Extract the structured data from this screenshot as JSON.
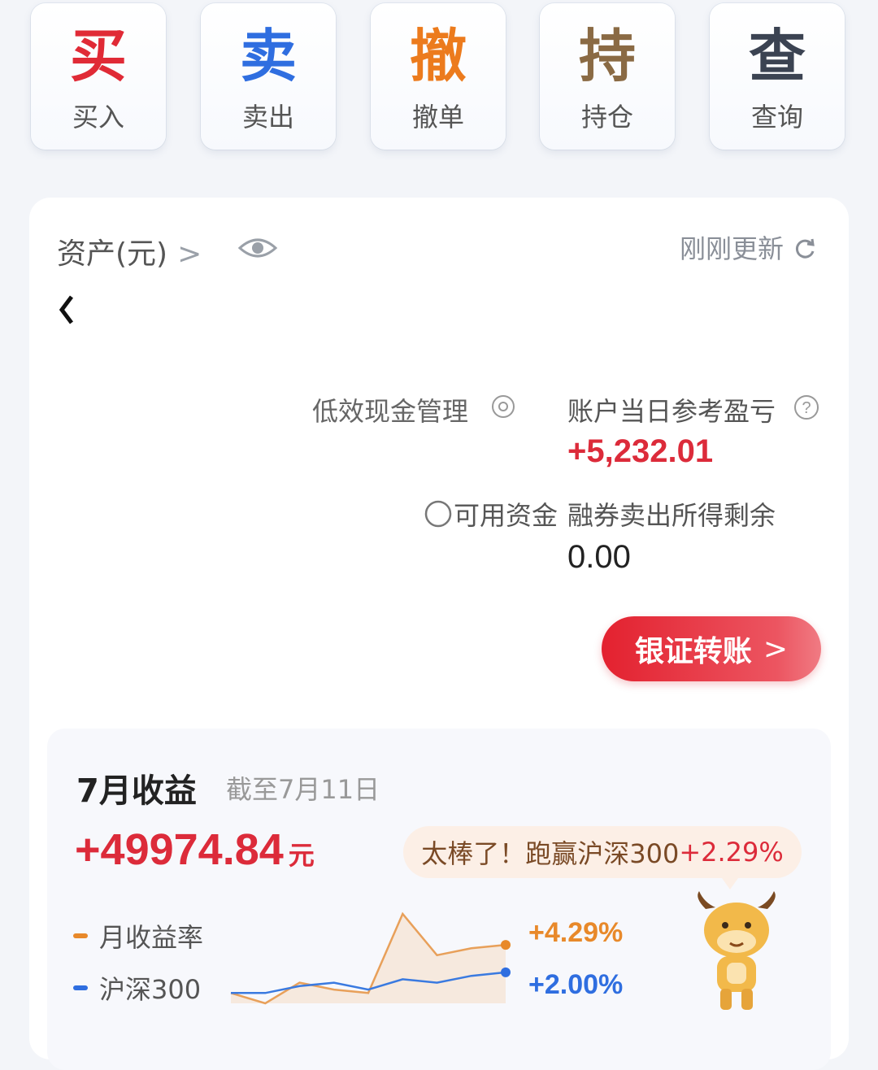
{
  "actions": [
    {
      "big": "买",
      "label": "买入"
    },
    {
      "big": "卖",
      "label": "卖出"
    },
    {
      "big": "撤",
      "label": "撤单"
    },
    {
      "big": "持",
      "label": "持仓"
    },
    {
      "big": "查",
      "label": "查询"
    }
  ],
  "assets": {
    "title": "资产(元)",
    "updated": "刚刚更新",
    "label_a": "低效现金管理",
    "label_b": "账户当日参考盈亏",
    "pl_value": "+5,232.01",
    "label_c": "可用资金",
    "label_d": "融券卖出所得剩余",
    "value_d": "0.00",
    "transfer_button": "银证转账"
  },
  "income": {
    "title": "7月收益",
    "as_of": "截至7月11日",
    "value": "+49974.84",
    "unit": "元",
    "bubble_text": "太棒了！跑赢沪深300",
    "bubble_delta": "+2.29%",
    "legend_monthly": "月收益率",
    "legend_index": "沪深300",
    "monthly_pct": "+4.29%",
    "index_pct": "+2.00%"
  },
  "colors": {
    "accent_red": "#dc2b3a",
    "monthly_orange": "#e8892a",
    "index_blue": "#2f6ee0"
  },
  "icons": [
    "eye-icon",
    "refresh-icon",
    "back-arrow-icon",
    "help-icon",
    "radio-icon",
    "chevron-right-icon",
    "mascot-ox-icon"
  ],
  "chart_data": {
    "type": "line",
    "title": "",
    "xlabel": "",
    "ylabel": "",
    "series": [
      {
        "name": "月收益率",
        "values": [
          0.0,
          -0.3,
          0.3,
          0.1,
          0.0,
          2.3,
          1.1,
          1.3,
          1.4
        ]
      },
      {
        "name": "沪深300",
        "values": [
          0.0,
          0.0,
          0.2,
          0.3,
          0.1,
          0.4,
          0.3,
          0.5,
          0.6
        ]
      }
    ]
  }
}
